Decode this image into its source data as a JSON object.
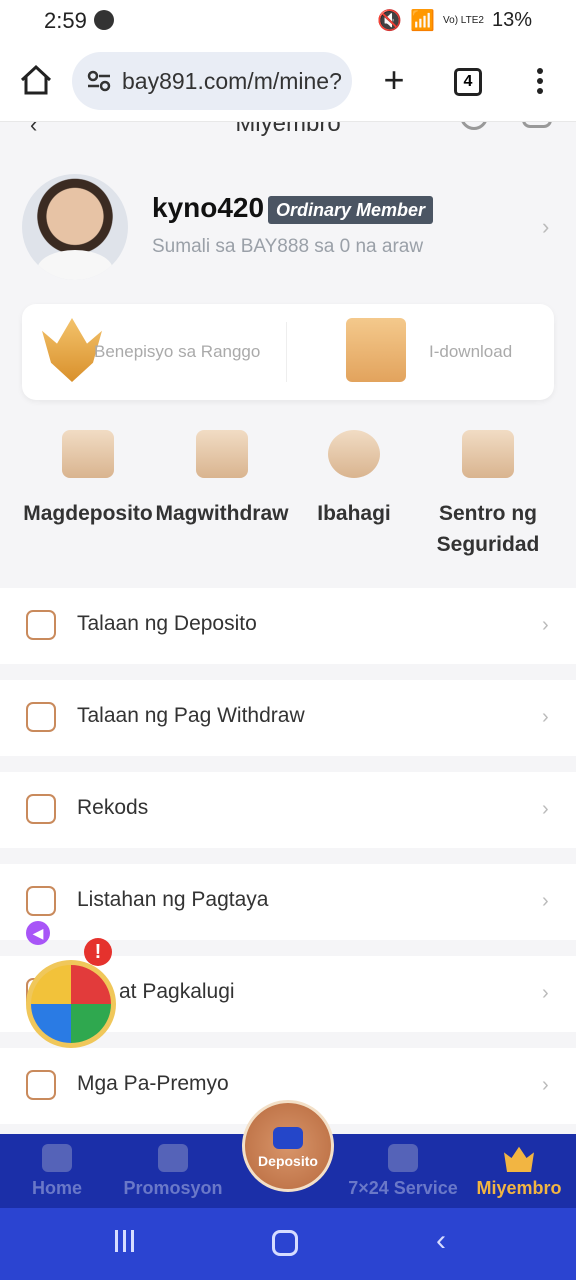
{
  "status_bar": {
    "time": "2:59",
    "network": "Vo) LTE2",
    "battery": "13%"
  },
  "browser": {
    "url": "bay891.com/m/mine?",
    "tab_count": "4"
  },
  "header": {
    "title": "Miyembro"
  },
  "profile": {
    "username": "kyno420",
    "member_level": "Ordinary Member",
    "joined_text": "Sumali sa BAY888 sa 0 na araw"
  },
  "promo": {
    "left_label": "Benepisyo sa Ranggo",
    "right_label": "I-download"
  },
  "quick_actions": [
    {
      "label": "Magdeposito",
      "icon": "wallet-icon"
    },
    {
      "label": "Magwithdraw",
      "icon": "calendar-wallet-icon"
    },
    {
      "label": "Ibahagi",
      "icon": "share-icon"
    },
    {
      "label": "Sentro ng Seguridad",
      "icon": "security-card-icon"
    }
  ],
  "menu_items": [
    {
      "label": "Talaan ng Deposito",
      "icon": "deposit-record-icon"
    },
    {
      "label": "Talaan ng Pag Withdraw",
      "icon": "withdraw-record-icon"
    },
    {
      "label": "Rekods",
      "icon": "records-icon"
    },
    {
      "label": "Listahan ng Pagtaya",
      "icon": "bet-list-icon"
    },
    {
      "label": "at Pagkalugi",
      "icon": "profit-loss-icon"
    },
    {
      "label": "Mga Pa-Premyo",
      "icon": "gift-icon"
    }
  ],
  "bottom_nav": {
    "home": "Home",
    "promos": "Promosyon",
    "deposit": "Deposito",
    "service": "7×24 Service",
    "member": "Miyembro"
  },
  "float": {
    "alert": "!"
  },
  "colors": {
    "nav_bg": "#1b2fa8",
    "active": "#f2b542",
    "accent": "#c98a5c"
  }
}
